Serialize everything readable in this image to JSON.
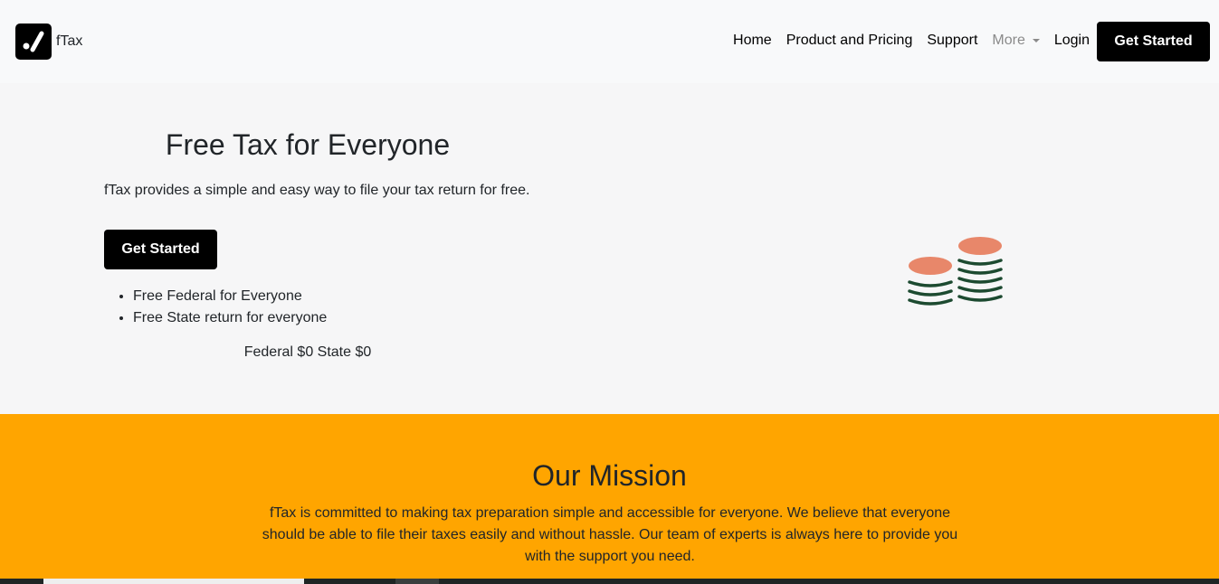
{
  "brand": {
    "name": "fTax"
  },
  "nav": {
    "items": [
      "Home",
      "Product and Pricing",
      "Support"
    ],
    "more_label": "More",
    "login_label": "Login",
    "cta_label": "Get Started"
  },
  "hero": {
    "title": "Free Tax for Everyone",
    "subtitle": "fTax provides a simple and easy way to file your tax return for free.",
    "cta_label": "Get Started",
    "features": [
      "Free Federal for Everyone",
      "Free State return for everyone"
    ],
    "prices": "Federal $0 State $0",
    "illustration_icon": "coins-icon"
  },
  "mission": {
    "title": "Our Mission",
    "text": "fTax is committed to making tax preparation simple and accessible for everyone. We believe that everyone should be able to file their taxes easily and without hassle. Our team of experts is always here to provide you with the support you need."
  },
  "colors": {
    "accent": "#ffa500",
    "button_bg": "#000000",
    "coin_top": "#e8876a",
    "coin_stack": "#1c4a30"
  }
}
